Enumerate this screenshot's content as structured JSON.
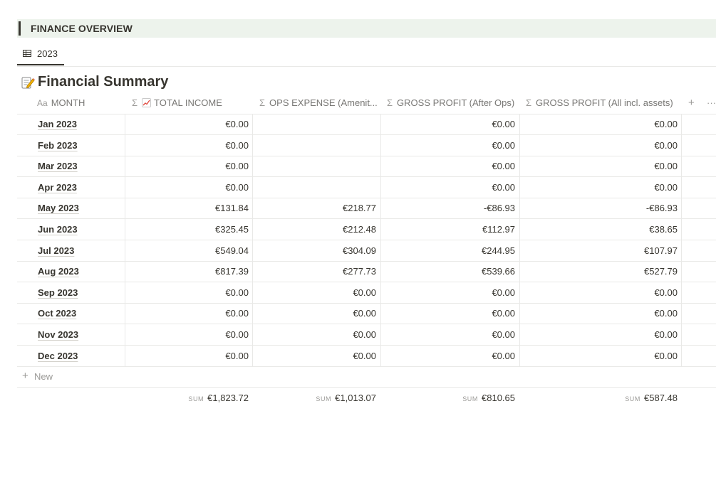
{
  "banner": {
    "title": "FINANCE OVERVIEW"
  },
  "tabs": [
    {
      "label": "2023",
      "icon": "table-icon"
    }
  ],
  "database": {
    "title": "Financial Summary",
    "emoji": "memo-pencil"
  },
  "columns": {
    "month": {
      "prefix": "Aa",
      "label": "MONTH"
    },
    "income": {
      "prefix": "Σ",
      "label": "TOTAL INCOME",
      "emoji": "chart-increasing"
    },
    "ops": {
      "prefix": "Σ",
      "label": "OPS EXPENSE (Amenit..."
    },
    "gross_ops": {
      "prefix": "Σ",
      "label": "GROSS PROFIT (After Ops)"
    },
    "gross_all": {
      "prefix": "Σ",
      "label": "GROSS PROFIT (All incl. assets)"
    },
    "add": "+",
    "more": "···"
  },
  "rows": [
    {
      "month": "Jan 2023",
      "income": "€0.00",
      "ops": "",
      "gross_ops": "€0.00",
      "gross_all": "€0.00"
    },
    {
      "month": "Feb 2023",
      "income": "€0.00",
      "ops": "",
      "gross_ops": "€0.00",
      "gross_all": "€0.00"
    },
    {
      "month": "Mar 2023",
      "income": "€0.00",
      "ops": "",
      "gross_ops": "€0.00",
      "gross_all": "€0.00"
    },
    {
      "month": "Apr 2023",
      "income": "€0.00",
      "ops": "",
      "gross_ops": "€0.00",
      "gross_all": "€0.00"
    },
    {
      "month": "May 2023",
      "income": "€131.84",
      "ops": "€218.77",
      "gross_ops": "-€86.93",
      "gross_all": "-€86.93"
    },
    {
      "month": "Jun 2023",
      "income": "€325.45",
      "ops": "€212.48",
      "gross_ops": "€112.97",
      "gross_all": "€38.65"
    },
    {
      "month": "Jul 2023",
      "income": "€549.04",
      "ops": "€304.09",
      "gross_ops": "€244.95",
      "gross_all": "€107.97"
    },
    {
      "month": "Aug 2023",
      "income": "€817.39",
      "ops": "€277.73",
      "gross_ops": "€539.66",
      "gross_all": "€527.79"
    },
    {
      "month": "Sep 2023",
      "income": "€0.00",
      "ops": "€0.00",
      "gross_ops": "€0.00",
      "gross_all": "€0.00"
    },
    {
      "month": "Oct 2023",
      "income": "€0.00",
      "ops": "€0.00",
      "gross_ops": "€0.00",
      "gross_all": "€0.00"
    },
    {
      "month": "Nov 2023",
      "income": "€0.00",
      "ops": "€0.00",
      "gross_ops": "€0.00",
      "gross_all": "€0.00"
    },
    {
      "month": "Dec 2023",
      "income": "€0.00",
      "ops": "€0.00",
      "gross_ops": "€0.00",
      "gross_all": "€0.00"
    }
  ],
  "new_row": {
    "plus": "+",
    "label": "New"
  },
  "sums": {
    "label": "SUM",
    "income": "€1,823.72",
    "ops": "€1,013.07",
    "gross_ops": "€810.65",
    "gross_all": "€587.48"
  }
}
